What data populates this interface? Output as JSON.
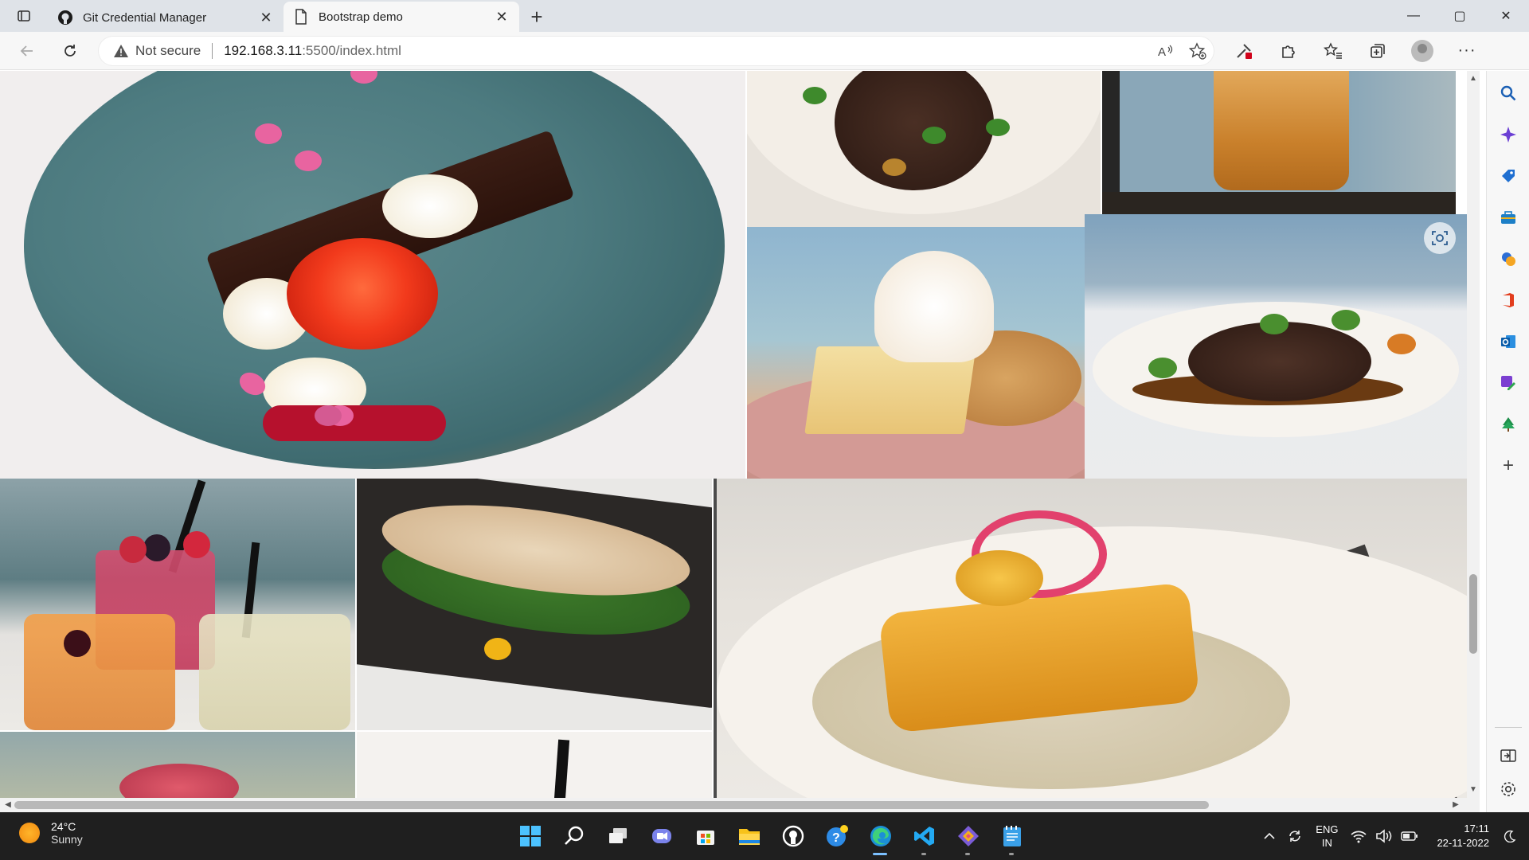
{
  "browser": {
    "tabs": [
      {
        "title": "Git Credential Manager",
        "icon": "github-icon",
        "active": false
      },
      {
        "title": "Bootstrap demo",
        "icon": "page-icon",
        "active": true
      }
    ],
    "new_tab_label": "+",
    "address": {
      "security_label": "Not secure",
      "url_host": "192.168.3.11",
      "url_path": ":5500/index.html"
    },
    "window_controls": {
      "minimize": "—",
      "maximize": "▢",
      "close": "✕"
    }
  },
  "page": {
    "gallery": [
      {
        "name": "dessert-rose-plate"
      },
      {
        "name": "steak-plate-top"
      },
      {
        "name": "whisky-glass"
      },
      {
        "name": "cheesecake"
      },
      {
        "name": "steak-plate"
      },
      {
        "name": "cocktails"
      },
      {
        "name": "crab-salad-slate"
      },
      {
        "name": "fish-plate"
      },
      {
        "name": "lakeside-dish"
      },
      {
        "name": "drink-straw"
      }
    ]
  },
  "sidebar": {
    "items": [
      "search-icon",
      "copilot-icon",
      "tag-icon",
      "toolbox-icon",
      "games-icon",
      "office-icon",
      "outlook-icon",
      "designer-icon",
      "tree-icon",
      "add-icon"
    ],
    "footer": [
      "split-screen-icon",
      "settings-icon"
    ]
  },
  "taskbar": {
    "weather": {
      "temp": "24°C",
      "condition": "Sunny"
    },
    "apps": [
      "windows-start",
      "search",
      "task-view",
      "teams-chat",
      "microsoft-store",
      "file-explorer",
      "github-desktop",
      "help",
      "edge",
      "vscode",
      "git-tool",
      "notepad"
    ],
    "language": {
      "line1": "ENG",
      "line2": "IN"
    },
    "clock": {
      "time": "17:11",
      "date": "22-11-2022"
    }
  }
}
